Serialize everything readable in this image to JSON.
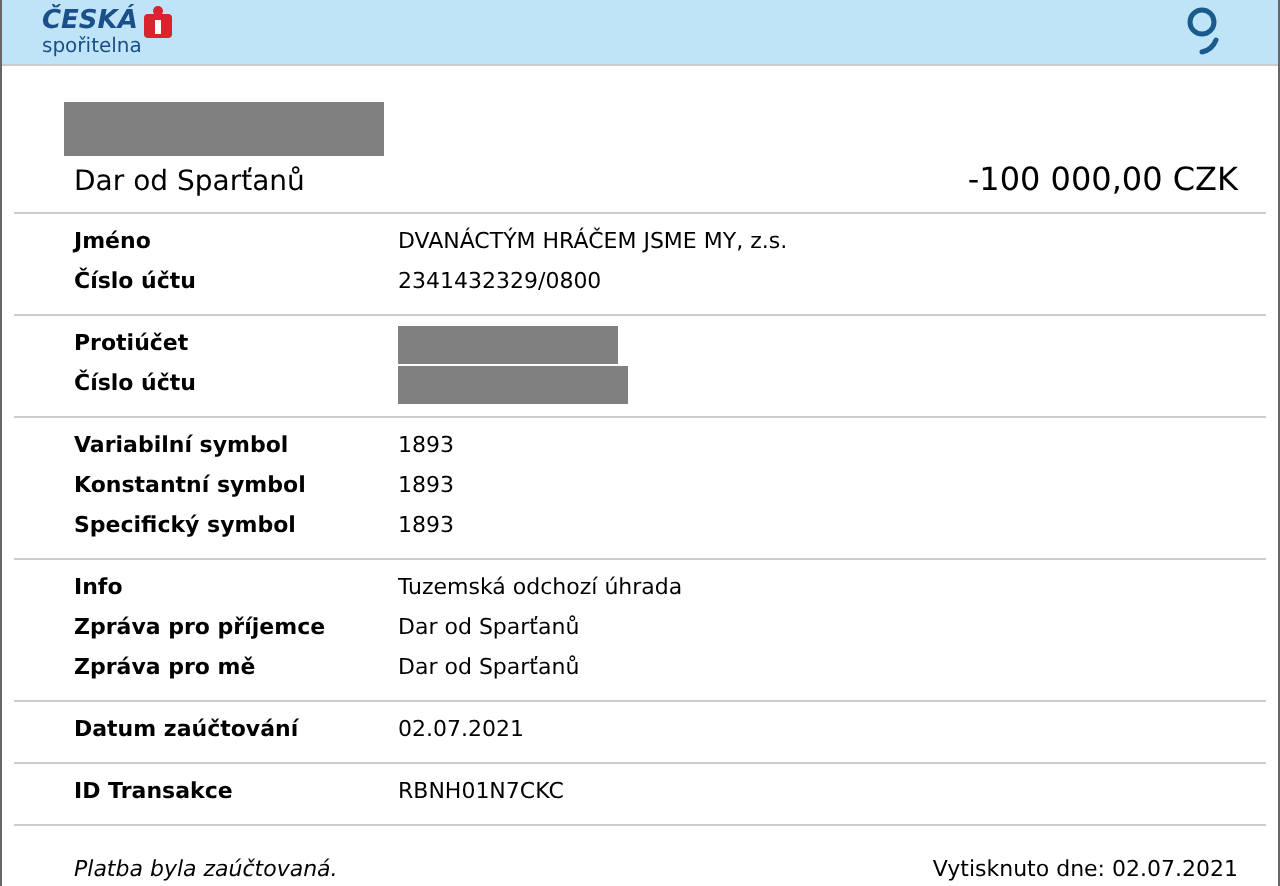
{
  "header": {
    "logo": {
      "name": "ČESKÁ",
      "subtitle": "spořitelna"
    }
  },
  "title": {
    "redacted": true,
    "text": "Dar od Sparťanů",
    "amount": "-100 000,00 CZK"
  },
  "sections": [
    {
      "rows": [
        {
          "label": "Jméno",
          "value": "DVANÁCTÝM HRÁČEM JSME MY, z.s.",
          "redacted": false
        },
        {
          "label": "Číslo účtu",
          "value": "2341432329/0800",
          "redacted": false
        }
      ]
    },
    {
      "rows": [
        {
          "label": "Protiúčet",
          "redacted": true
        },
        {
          "label": "Číslo účtu",
          "redacted": true
        }
      ]
    },
    {
      "rows": [
        {
          "label": "Variabilní symbol",
          "value": "1893",
          "redacted": false
        },
        {
          "label": "Konstantní symbol",
          "value": "1893",
          "redacted": false
        },
        {
          "label": "Specifický symbol",
          "value": "1893",
          "redacted": false
        }
      ]
    },
    {
      "rows": [
        {
          "label": "Info",
          "value": "Tuzemská odchozí úhrada",
          "redacted": false
        },
        {
          "label": "Zpráva pro příjemce",
          "value": "Dar od Sparťanů",
          "redacted": false
        },
        {
          "label": "Zpráva pro mě",
          "value": "Dar od Sparťanů",
          "redacted": false
        }
      ]
    },
    {
      "rows": [
        {
          "label": "Datum zaúčtování",
          "value": "02.07.2021",
          "redacted": false
        }
      ]
    },
    {
      "rows": [
        {
          "label": "ID Transakce",
          "value": "RBNH01N7CKC",
          "redacted": false
        }
      ]
    }
  ],
  "footer": {
    "status": "Platba byla zaúčtovaná.",
    "printed": "Vytisknuto dne: 02.07.2021"
  }
}
